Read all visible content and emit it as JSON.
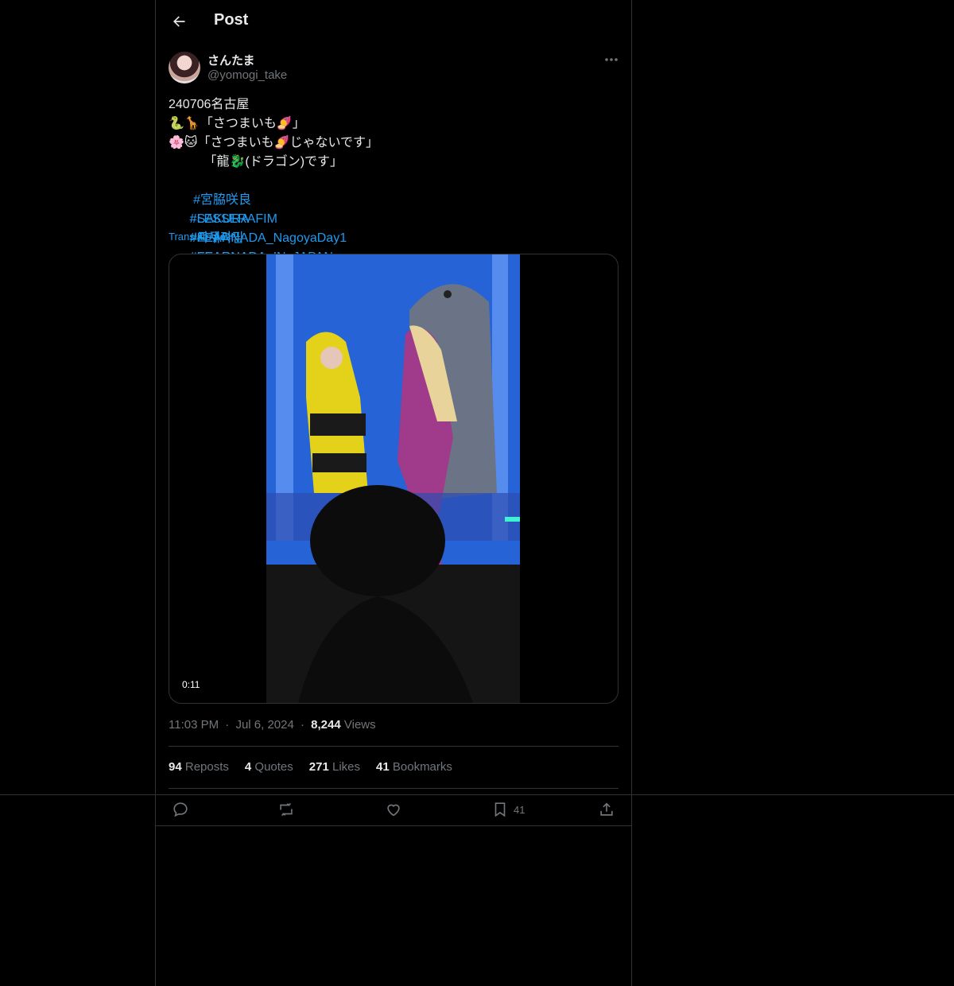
{
  "header": {
    "title": "Post",
    "back_icon": "arrow-left-icon"
  },
  "author": {
    "name": "さんたま",
    "handle": "@yomogi_take"
  },
  "tweet": {
    "lines": [
      "240706名古屋",
      "🐍🦒「さつまいも🍠」",
      "🌸🐱「さつまいも🍠じゃないです」",
      "          「龍🐉(ドラゴン)です」"
    ],
    "hashtags_line1": [
      "#宮脇咲良",
      "#SAKURA",
      "#사쿠라"
    ],
    "hashtags_line2": [
      "#LESSERAFIM",
      "#르세라핌",
      "#FEARNADA_IN_JAPAN"
    ],
    "hashtags_line3": [
      "#FEARNADA_NagoyaDay1",
      "#FEARNADA"
    ],
    "translate_label": "Translate post"
  },
  "media": {
    "duration": "0:11"
  },
  "meta": {
    "time": "11:03 PM",
    "date": "Jul 6, 2024",
    "views_count": "8,244",
    "views_label": "Views",
    "sep": "·"
  },
  "stats": [
    {
      "count": "94",
      "label": "Reposts"
    },
    {
      "count": "4",
      "label": "Quotes"
    },
    {
      "count": "271",
      "label": "Likes"
    },
    {
      "count": "41",
      "label": "Bookmarks"
    }
  ],
  "actions": {
    "bookmark_count": "41"
  },
  "colors": {
    "accent": "#1d9bf0",
    "muted": "#71767b",
    "text": "#e7e9ea",
    "border": "#2f3336"
  }
}
